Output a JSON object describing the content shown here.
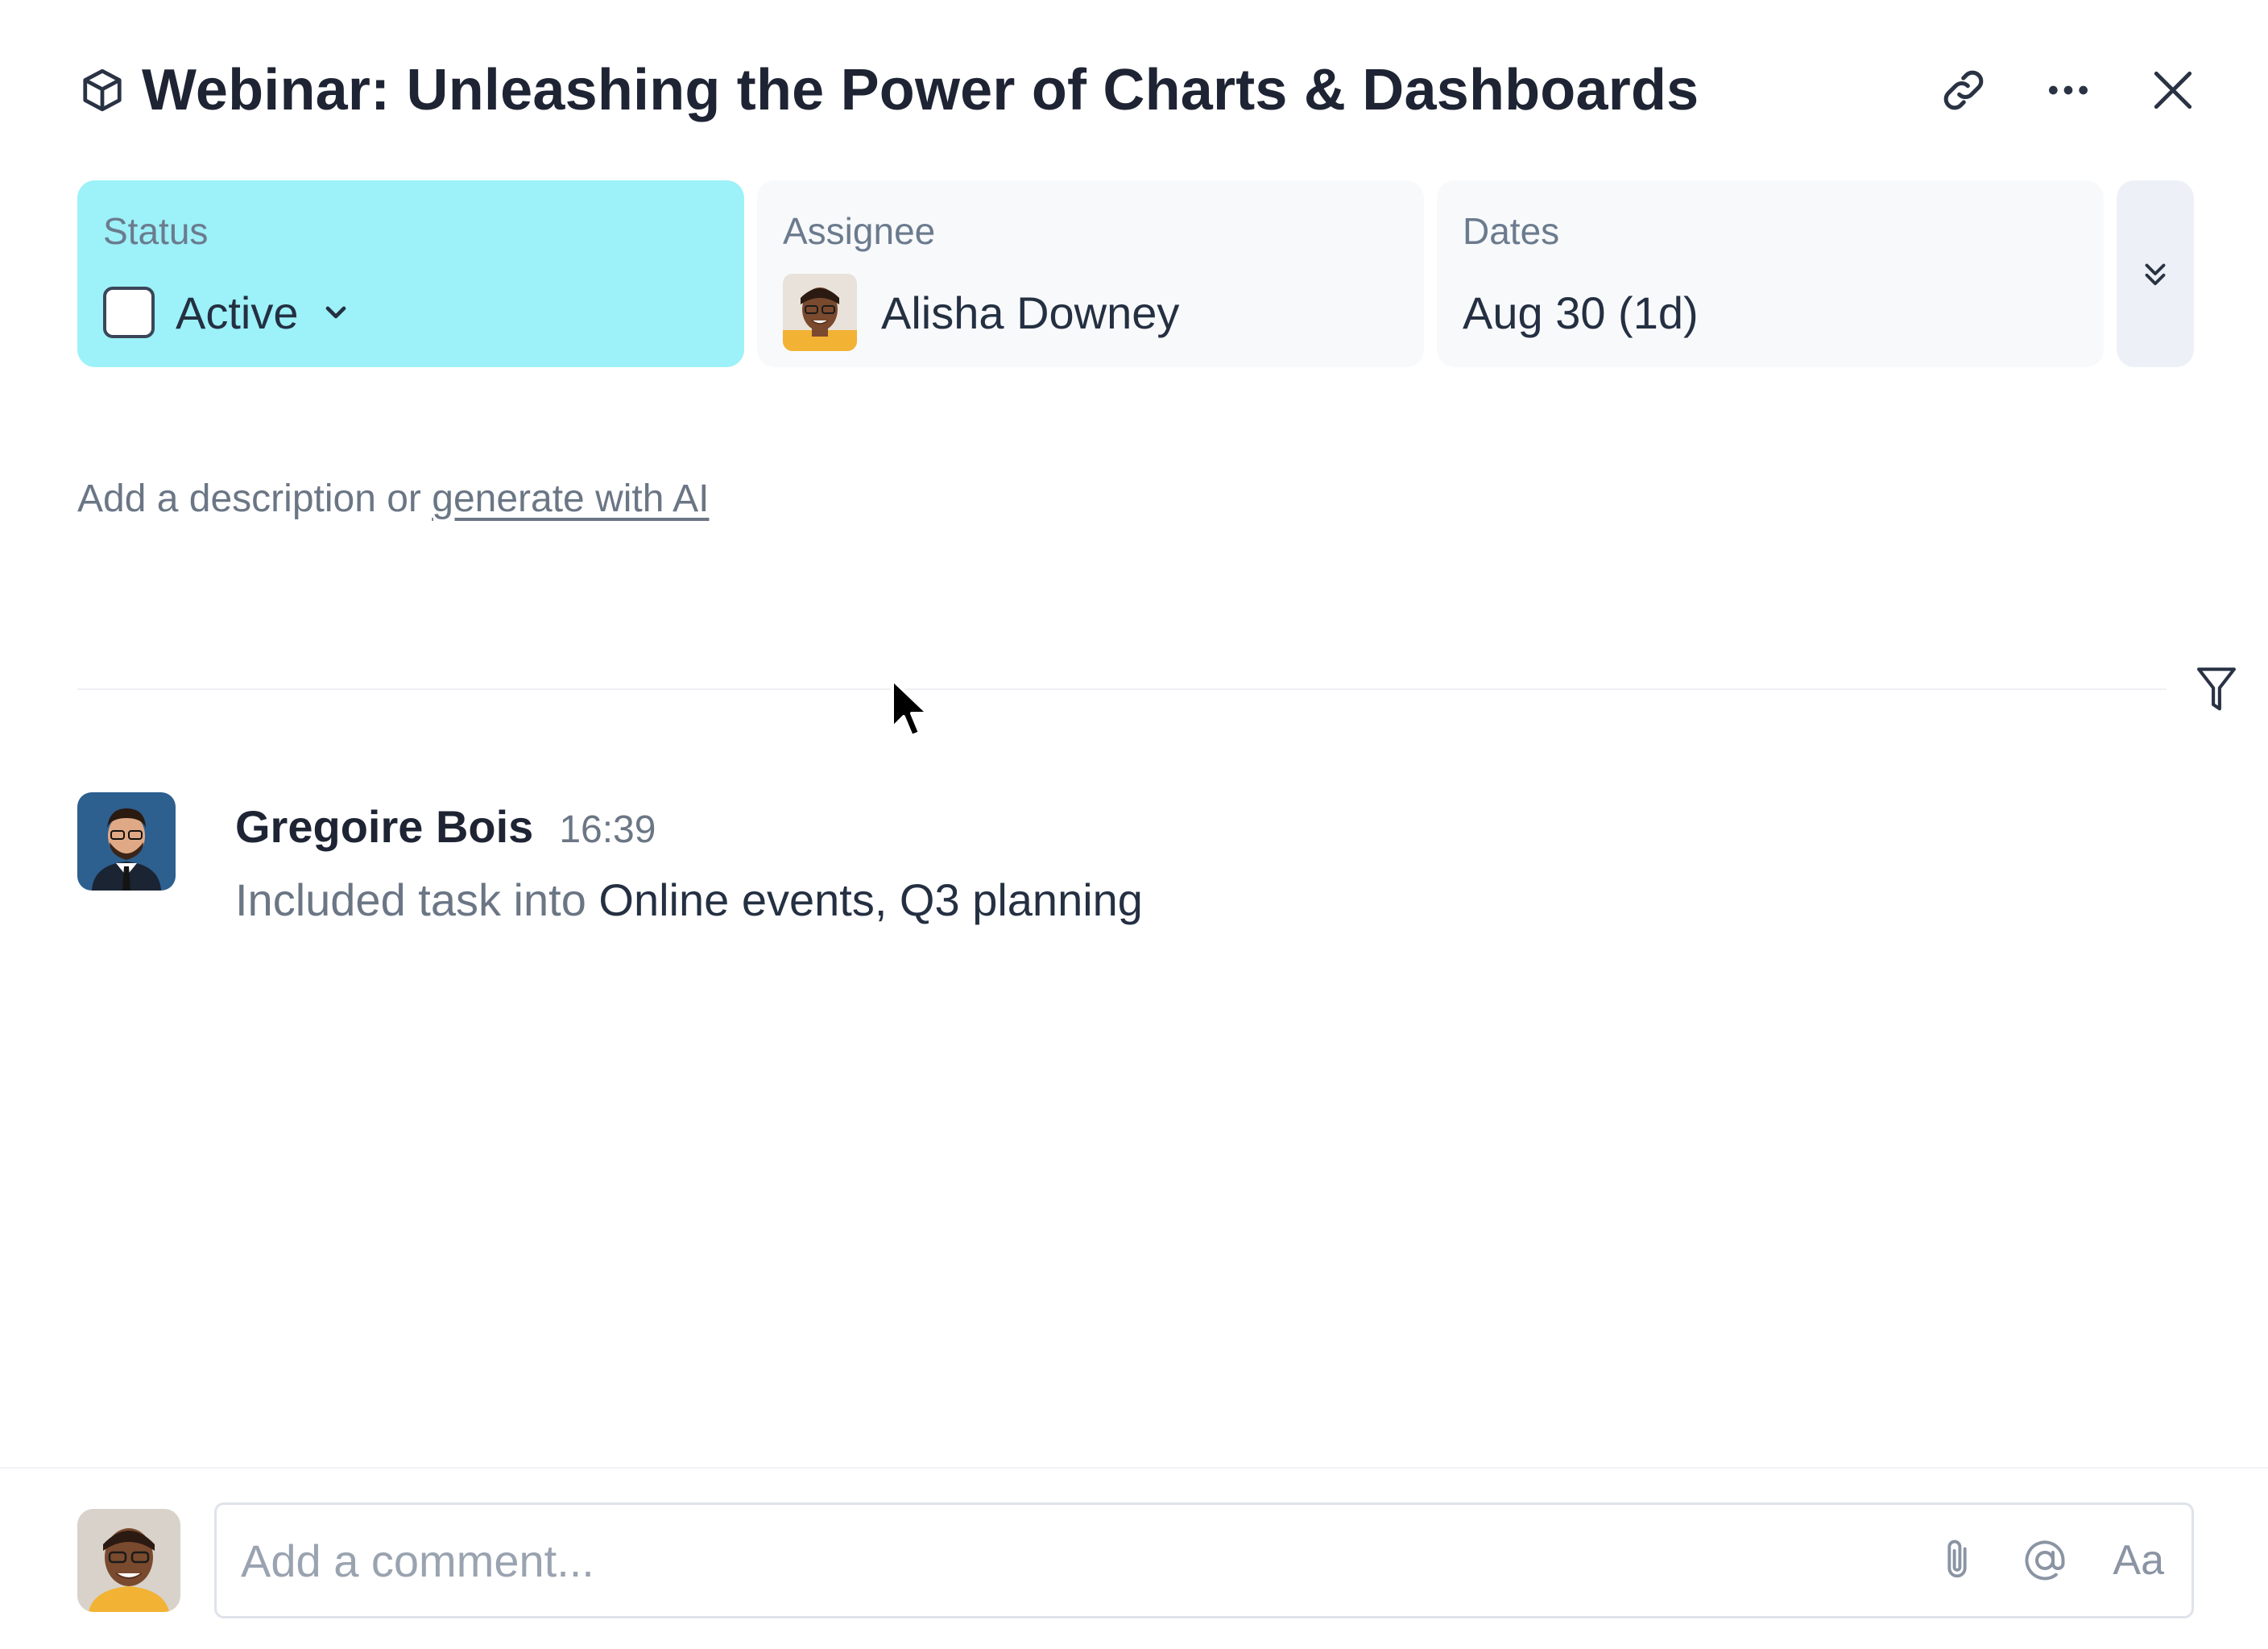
{
  "header": {
    "title": "Webinar: Unleashing the Power of Charts & Dashboards",
    "icons": [
      "cube-icon",
      "link-icon",
      "more-icon",
      "close-icon"
    ]
  },
  "fields": {
    "status": {
      "label": "Status",
      "value": "Active",
      "color": "#9df1f8"
    },
    "assignee": {
      "label": "Assignee",
      "value": "Alisha Downey"
    },
    "dates": {
      "label": "Dates",
      "value": "Aug 30 (1d)"
    }
  },
  "description": {
    "prefix": "Add a description or ",
    "link": "generate with AI"
  },
  "activity": [
    {
      "author": "Gregoire Bois",
      "time": "16:39",
      "text": "Included task into ",
      "target": "Online events, Q3 planning"
    }
  ],
  "comment": {
    "placeholder": "Add a comment...",
    "format_label": "Aa"
  }
}
